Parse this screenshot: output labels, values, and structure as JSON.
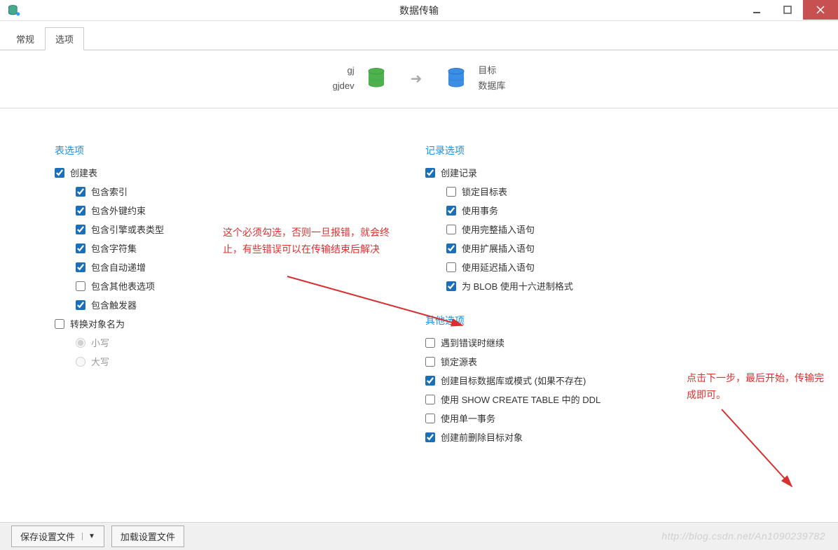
{
  "window": {
    "title": "数据传输"
  },
  "tabs": {
    "general": "常规",
    "options": "选项"
  },
  "header": {
    "src_line1": "gj",
    "src_line2": "gjdev",
    "dst_line1": "目标",
    "dst_line2": "数据库"
  },
  "table_options": {
    "title": "表选项",
    "create_table": "创建表",
    "include_index": "包含索引",
    "include_fk": "包含外键约束",
    "include_engine": "包含引擎或表类型",
    "include_charset": "包含字符集",
    "include_autoinc": "包含自动递增",
    "include_other": "包含其他表选项",
    "include_trigger": "包含触发器",
    "convert_name": "转换对象名为",
    "lower": "小写",
    "upper": "大写"
  },
  "record_options": {
    "title": "记录选项",
    "create_record": "创建记录",
    "lock_target": "锁定目标表",
    "use_txn": "使用事务",
    "full_insert": "使用完整插入语句",
    "ext_insert": "使用扩展插入语句",
    "delay_insert": "使用延迟插入语句",
    "blob_hex": "为 BLOB 使用十六进制格式"
  },
  "other_options": {
    "title": "其他选项",
    "continue_on_error": "遇到错误时继续",
    "lock_source": "锁定源表",
    "create_target_db": "创建目标数据库或模式 (如果不存在)",
    "use_show_create": "使用 SHOW CREATE TABLE 中的 DDL",
    "single_txn": "使用单一事务",
    "delete_before": "创建前删除目标对象"
  },
  "annotations": {
    "a1": "这个必须勾选，否则一旦报错，就会终止，有些错误可以在传输结束后解决",
    "a2": "点击下一步，最后开始，传输完成即可。"
  },
  "footer": {
    "save": "保存设置文件",
    "load": "加载设置文件"
  },
  "watermark": "http://blog.csdn.net/An1090239782"
}
